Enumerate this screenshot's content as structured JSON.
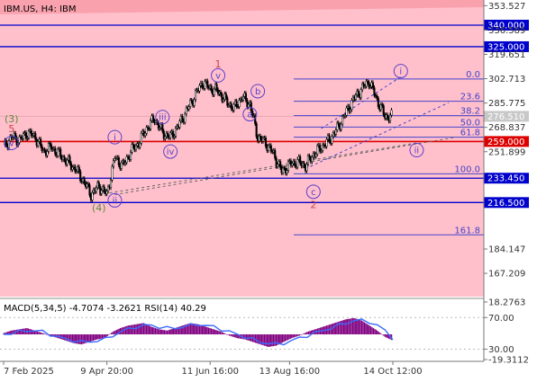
{
  "header": {
    "symbol": "IBM.US",
    "timeframe": "H4",
    "name": "IBM"
  },
  "indicator_header": "MACD(5,34,5) -4.7074 -3.2621 RSI(14) 40.29",
  "colors": {
    "background_zone": "#ffc0cb",
    "top_band": "#f9a2ae",
    "level_line": "#0000cc",
    "key_level_line": "#dd0000",
    "fibo_line": "#4444cc",
    "wave_label": "#5a3fd0",
    "wave_label_major": "#cc4444",
    "wave_label_green": "#5c8a3a",
    "candle": "#000000",
    "macd_hist": "#800080",
    "macd_signal": "#3a6cff",
    "rsi_line": "#e0e0ff"
  },
  "chart_data": [
    {
      "type": "candlestick",
      "title": "IBM.US, H4: IBM",
      "y_ticks": [
        "353.527",
        "336.589",
        "319.651",
        "302.713",
        "285.775",
        "268.837",
        "251.899",
        "184.147",
        "167.209"
      ],
      "ylim": [
        153.5,
        355
      ],
      "x_ticks": [
        "7 Feb 2025",
        "9 Apr 20:00",
        "11 Jun 16:00",
        "13 Aug 16:00",
        "14 Oct 12:00"
      ],
      "price_series": [
        {
          "date": "7 Feb 2025",
          "value": 255
        },
        {
          "value": 262
        },
        {
          "value": 260
        },
        {
          "value": 265
        },
        {
          "value": 262
        },
        {
          "value": 252
        },
        {
          "value": 255
        },
        {
          "value": 250
        },
        {
          "value": 245
        },
        {
          "value": 240
        },
        {
          "value": 232
        },
        {
          "value": 222
        },
        {
          "value": 228
        },
        {
          "date": "9 Apr 20:00",
          "value": 222
        },
        {
          "value": 248
        },
        {
          "value": 242
        },
        {
          "value": 252
        },
        {
          "value": 258
        },
        {
          "value": 268
        },
        {
          "value": 275
        },
        {
          "value": 265
        },
        {
          "value": 262
        },
        {
          "value": 270
        },
        {
          "value": 280
        },
        {
          "value": 290
        },
        {
          "value": 300
        },
        {
          "date": "11 Jun 16:00",
          "value": 296
        },
        {
          "value": 294
        },
        {
          "value": 287
        },
        {
          "value": 282
        },
        {
          "value": 290
        },
        {
          "value": 285
        },
        {
          "value": 262
        },
        {
          "value": 258
        },
        {
          "value": 250
        },
        {
          "value": 238
        },
        {
          "date": "13 Aug 16:00",
          "value": 243
        },
        {
          "value": 245
        },
        {
          "value": 242
        },
        {
          "value": 250
        },
        {
          "value": 255
        },
        {
          "value": 260
        },
        {
          "value": 268
        },
        {
          "value": 278
        },
        {
          "value": 288
        },
        {
          "value": 295
        },
        {
          "value": 301
        },
        {
          "value": 288
        },
        {
          "value": 276.5
        },
        {
          "date": "14 Oct 12:00",
          "value": 276.5
        }
      ],
      "horizontal_levels": [
        {
          "value": 340.0,
          "label": "340.000",
          "color": "blue"
        },
        {
          "value": 325.0,
          "label": "325.000",
          "color": "blue"
        },
        {
          "value": 259.0,
          "label": "259.000",
          "color": "red"
        },
        {
          "value": 233.45,
          "label": "233.450",
          "color": "blue"
        },
        {
          "value": 216.5,
          "label": "216.500",
          "color": "blue"
        }
      ],
      "current_price": "276.510",
      "fibonacci_levels": [
        {
          "ratio": "0.0",
          "value": 302.5
        },
        {
          "ratio": "23.6",
          "value": 287.0
        },
        {
          "ratio": "38.2",
          "value": 277.0
        },
        {
          "ratio": "50.0",
          "value": 269.0
        },
        {
          "ratio": "61.8",
          "value": 262.0
        },
        {
          "ratio": "100.0",
          "value": 236.5
        },
        {
          "ratio": "161.8",
          "value": 194.0
        }
      ],
      "wave_labels": [
        {
          "text": "(3)",
          "style": "green",
          "date_index": 1,
          "value": 275
        },
        {
          "text": "5",
          "style": "major",
          "date_index": 1,
          "value": 268
        },
        {
          "text": "v",
          "style": "circle",
          "date_index": 1,
          "value": 258
        },
        {
          "text": "(4)",
          "style": "green",
          "date_index": 12,
          "value": 213
        },
        {
          "text": "i",
          "style": "circle",
          "date_index": 14,
          "value": 262
        },
        {
          "text": "ii",
          "style": "circle",
          "date_index": 14,
          "value": 218
        },
        {
          "text": "iii",
          "style": "circle",
          "date_index": 20,
          "value": 276
        },
        {
          "text": "iv",
          "style": "circle",
          "date_index": 21,
          "value": 252
        },
        {
          "text": "1",
          "style": "major",
          "date_index": 27,
          "value": 313
        },
        {
          "text": "v",
          "style": "circle",
          "date_index": 27,
          "value": 305
        },
        {
          "text": "b",
          "style": "circle",
          "date_index": 32,
          "value": 294
        },
        {
          "text": "a",
          "style": "circle",
          "date_index": 31,
          "value": 278
        },
        {
          "text": "c",
          "style": "circle",
          "date_index": 39,
          "value": 224
        },
        {
          "text": "2",
          "style": "major",
          "date_index": 39,
          "value": 215
        },
        {
          "text": "i",
          "style": "circle",
          "date_index": 50,
          "value": 308
        },
        {
          "text": "ii",
          "style": "circle",
          "date_index": 52,
          "value": 253
        }
      ]
    },
    {
      "type": "indicator",
      "title": "MACD(5,34,5) -4.7074 -3.2621 RSI(14) 40.29",
      "y_ticks": [
        "18.2763",
        "70.00",
        "30.00",
        "-19.3112"
      ],
      "macd_histogram": [
        1,
        3,
        4,
        5,
        3,
        1,
        -1,
        -3,
        -5,
        -7,
        -8,
        -6,
        -4,
        -3,
        2,
        5,
        7,
        8,
        9,
        6,
        4,
        3,
        5,
        7,
        9,
        8,
        6,
        4,
        2,
        -1,
        -3,
        -4,
        -6,
        -8,
        -10,
        -9,
        -6,
        -3,
        -1,
        2,
        4,
        6,
        8,
        10,
        12,
        13,
        11,
        7,
        3,
        -2,
        -5
      ],
      "macd_signal": [
        0,
        1,
        2,
        3,
        3,
        2,
        0,
        -2,
        -4,
        -5,
        -6,
        -6,
        -5,
        -4,
        -1,
        2,
        4,
        6,
        7,
        7,
        6,
        5,
        5,
        6,
        7,
        8,
        7,
        6,
        4,
        2,
        0,
        -2,
        -4,
        -6,
        -7,
        -8,
        -7,
        -5,
        -3,
        -1,
        1,
        3,
        5,
        7,
        9,
        11,
        11,
        10,
        7,
        3,
        -3
      ]
    }
  ]
}
